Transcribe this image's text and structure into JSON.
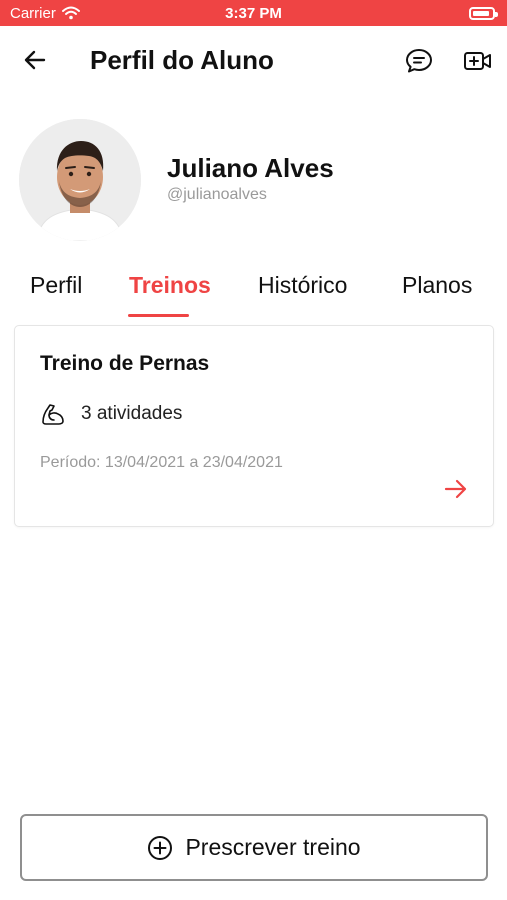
{
  "status_bar": {
    "carrier": "Carrier",
    "time": "3:37 PM"
  },
  "header": {
    "title": "Perfil do Aluno"
  },
  "profile": {
    "name": "Juliano Alves",
    "handle": "@julianoalves"
  },
  "tabs": [
    {
      "label": "Perfil",
      "active": false
    },
    {
      "label": "Treinos",
      "active": true
    },
    {
      "label": "Histórico",
      "active": false
    },
    {
      "label": "Planos",
      "active": false
    }
  ],
  "workout_card": {
    "title": "Treino de Pernas",
    "activities": "3 atividades",
    "period": "Período: 13/04/2021 a 23/04/2021"
  },
  "actions": {
    "prescribe_label": "Prescrever treino"
  },
  "colors": {
    "accent": "#ef4444",
    "text": "#111111",
    "muted": "#9a9a9a",
    "border": "#e5e5e5"
  },
  "icons": [
    "wifi-icon",
    "battery-icon",
    "back-arrow-icon",
    "chat-icon",
    "video-call-icon",
    "muscle-icon",
    "arrow-right-icon",
    "plus-circle-icon"
  ]
}
